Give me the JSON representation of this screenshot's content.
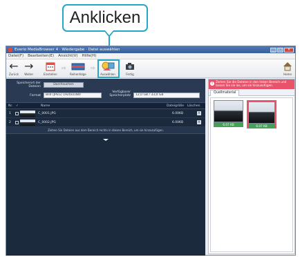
{
  "callout": {
    "text": "Anklicken"
  },
  "window": {
    "title": "Everio MediaBrowser 4 · Wiedergabe · Datei auswählen",
    "buttons": [
      "_",
      "□",
      "×"
    ]
  },
  "menu": [
    "Datei(F)",
    "Bearbeiten(E)",
    "Ansicht(V)",
    "Hilfe(H)"
  ],
  "toolbar": {
    "back_label": "Zurück",
    "forward_label": "Weiter",
    "step1_label": "Einstellen",
    "step2_label": "Reihenfolge",
    "step3_label": "Auswählen",
    "step4_label": "Fertig",
    "home_label": "Home",
    "arrow": "⇨"
  },
  "form": {
    "save_label": "Speicherort der Dateien",
    "save_button": "Durchsuchen",
    "format_label": "Format",
    "format_value": "Bild (JPEG) 1920x1080",
    "size_label": "Verfügbarer Speicherplatz",
    "size_value": "12,0 GB / 33,0 GB"
  },
  "list": {
    "headers": {
      "no": "Nr.",
      "check": "✓",
      "name": "Name",
      "size": "Dateigröße",
      "delete": "Löschen"
    },
    "rows": [
      {
        "no": "1",
        "name": "C_0001.JPG",
        "size": "6.00KB"
      },
      {
        "no": "2",
        "name": "C_0002.JPG",
        "size": "6.00KB"
      }
    ],
    "drop_hint": "Ziehen Sie Dateien aus dem Bereich rechts in diesen Bereich, um sie hinzuzufügen."
  },
  "panel": {
    "notice": "Ziehen Sie die Dateien in den linken Bereich und lassen Sie sie los, um sie hinzuzufügen.",
    "tab": "Quellmaterial",
    "tiles": [
      {
        "caption": "6.07 KB",
        "selected": false
      },
      {
        "caption": "6.07 KB",
        "selected": true
      }
    ]
  },
  "colors": {
    "callout": "#23a7c9",
    "notice": "#e8536a",
    "caption_bar": "#45a058",
    "list_bg": "#1c2a3e"
  }
}
